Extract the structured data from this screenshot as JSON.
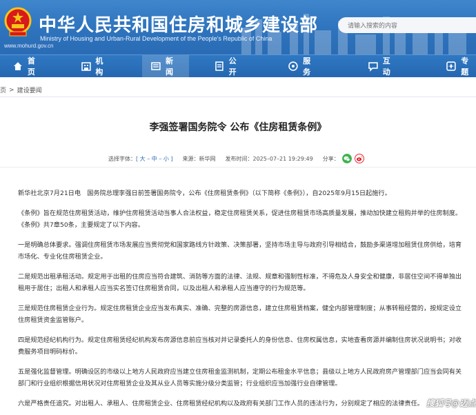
{
  "header": {
    "site_url": "www.mohurd.gov.cn",
    "title_cn": "中华人民共和国住房和城乡建设部",
    "title_en": "Ministry of Housing and Urban-Rural Development of the People's Republic of China",
    "search_placeholder": "请输入搜索的内容"
  },
  "nav": {
    "items": [
      {
        "label": "首页",
        "icon": "home-icon"
      },
      {
        "label": "机构",
        "icon": "org-icon"
      },
      {
        "label": "新闻",
        "icon": "news-icon"
      },
      {
        "label": "公开",
        "icon": "disclosure-icon"
      },
      {
        "label": "服务",
        "icon": "service-icon"
      },
      {
        "label": "互动",
        "icon": "interaction-icon"
      },
      {
        "label": "专题",
        "icon": "topic-icon"
      }
    ],
    "active": "新闻"
  },
  "breadcrumb": {
    "items": [
      "首页",
      ">",
      "建设要闻"
    ],
    "prefix": "页"
  },
  "article": {
    "title": "李强签署国务院令 公布《住房租赁条例》",
    "font_label": "选择字体：",
    "font_sizes": "[ 大 – 中 – 小 ]",
    "source_label": "来源：新华网",
    "published_label": "发布时间：2025–07–21 19:29:49",
    "share_label": "分享：",
    "paragraphs": [
      "新华社北京7月21日电　国务院总理李强日前签署国务院令，公布《住房租赁条例》（以下简称《条例》），自2025年9月15日起施行。",
      "《条例》旨在规范住房租赁活动，维护住房租赁活动当事人合法权益，稳定住房租赁关系，促进住房租赁市场高质量发展，推动加快建立租购并举的住房制度。《条例》共7章50条，主要规定了以下内容。",
      "一是明确总体要求。强调住房租赁市场发展应当贯彻党和国家路线方针政策、决策部署，坚持市场主导与政府引导相结合，鼓励多渠道增加租赁住房供给，培育市场化、专业化住房租赁企业。",
      "二是规范出租承租活动。规定用于出租的住房应当符合建筑、消防等方面的法律、法规、规章和强制性标准，不得危及人身安全和健康，非居住空间不得单独出租用于居住；出租人和承租人应当实名签订住房租赁合同，以及出租人和承租人应当遵守的行为规范等。",
      "三是规范住房租赁企业行为。规定住房租赁企业应当发布真实、准确、完整的房源信息，建立住房租赁档案，健全内部管理制度；从事转租经营的，按规定设立住房租赁资金监管账户。",
      "四是规范经纪机构行为。规定住房租赁经纪机构发布房源信息前应当核对并记录委托人的身份信息、住房权属信息，实地查看房源并编制住房状况说明书；对收费服务项目明码标价。",
      "五是强化监督管理。明确设区的市级以上地方人民政府应当建立住房租金监测机制，定期公布租金水平信息；县级以上地方人民政府房产管理部门应当会同有关部门和行业组织根据信用状况对住房租赁企业及其从业人员等实施分级分类监管；行业组织应当加强行业自律管理。",
      "六是严格责任追究。对出租人、承租人、住房租赁企业、住房租赁经纪机构以及政府有关部门工作人员的违法行为，分别规定了相应的法律责任。"
    ]
  },
  "watermark": "搜狐号@迈点",
  "colors": {
    "header_blue": "#2e73bd",
    "nav_blue": "#2567b0",
    "link_blue": "#2e6ab5",
    "emblem_red": "#d71a1a",
    "emblem_gold": "#f5c518"
  }
}
